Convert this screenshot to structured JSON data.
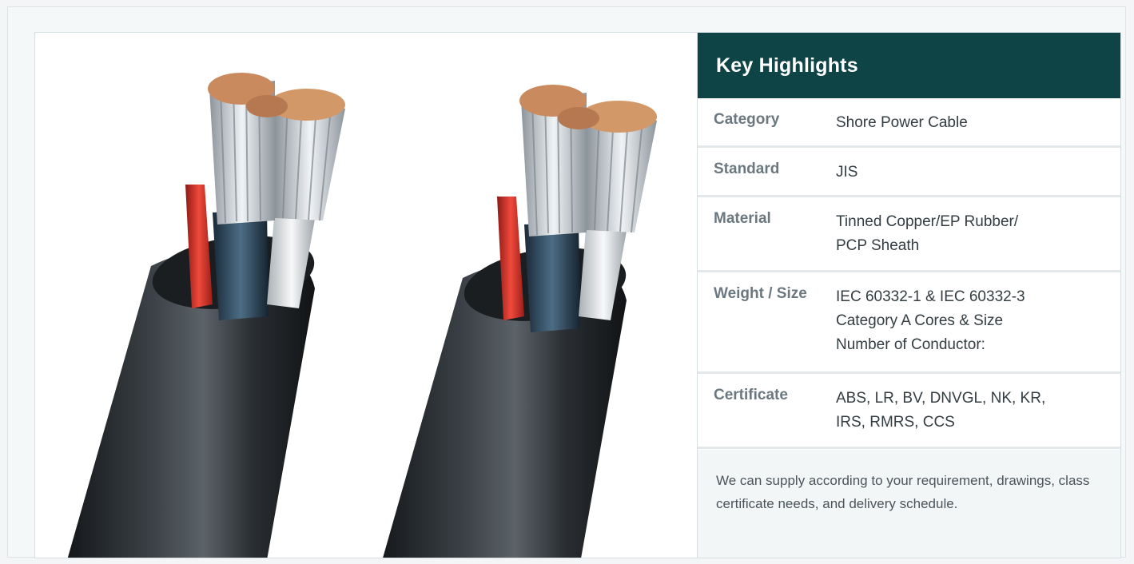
{
  "highlights": {
    "title": "Key Highlights",
    "rows": [
      {
        "label": "Category",
        "lines": [
          "Shore Power Cable"
        ]
      },
      {
        "label": "Standard",
        "lines": [
          "JIS"
        ]
      },
      {
        "label": "Material",
        "lines": [
          "Tinned Copper/EP Rubber/",
          "PCP Sheath"
        ]
      },
      {
        "label": "Weight / Size",
        "lines": [
          "IEC 60332-1 & IEC 60332-3",
          "Category A Cores & Size",
          "Number of Conductor:"
        ]
      },
      {
        "label": "Certificate",
        "lines": [
          "ABS, LR, BV, DNVGL, NK, KR,",
          "IRS, RMRS, CCS"
        ]
      }
    ],
    "note": "We can supply according to your requirement, drawings, class certificate needs, and delivery schedule."
  },
  "colors": {
    "header_bg": "#0e4446",
    "sheath": "#2b2f33",
    "copper": "#c98a5e",
    "core_red": "#d8322a"
  }
}
